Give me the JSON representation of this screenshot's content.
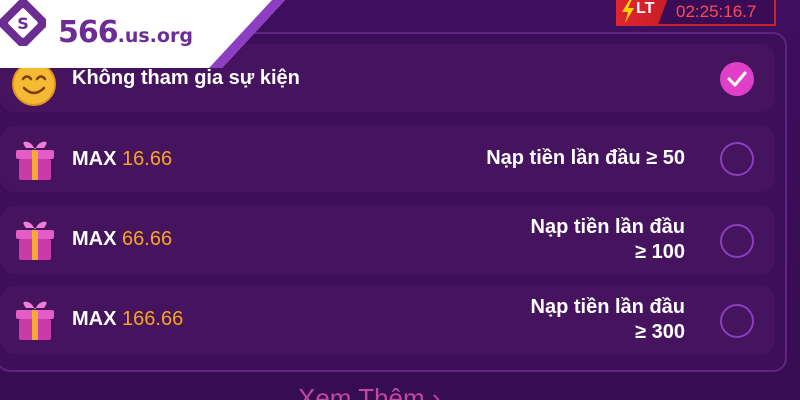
{
  "logo": {
    "number": "566",
    "suffix": ".us.org"
  },
  "timer": {
    "badge": "LT",
    "time": "02:25:16.7"
  },
  "options": [
    {
      "label": "Không tham gia sự kiện",
      "selected": true,
      "icon": "smiley-icon"
    },
    {
      "prefix": "MAX",
      "amount": "16.66",
      "condition_line1": "Nạp tiền lần đầu ≥ 50",
      "condition_line2": "",
      "selected": false,
      "icon": "gift-icon"
    },
    {
      "prefix": "MAX",
      "amount": "66.66",
      "condition_line1": "Nạp tiền lần đầu",
      "condition_line2": "≥ 100",
      "selected": false,
      "icon": "gift-icon"
    },
    {
      "prefix": "MAX",
      "amount": "166.66",
      "condition_line1": "Nạp tiền lần đầu",
      "condition_line2": "≥ 300",
      "selected": false,
      "icon": "gift-icon"
    }
  ],
  "footer": {
    "see_more": "Xem Thêm ›"
  },
  "colors": {
    "background": "#3d0e5a",
    "accent": "#e040c8",
    "amount": "#f7a51c",
    "timer": "#ff4a5a"
  }
}
